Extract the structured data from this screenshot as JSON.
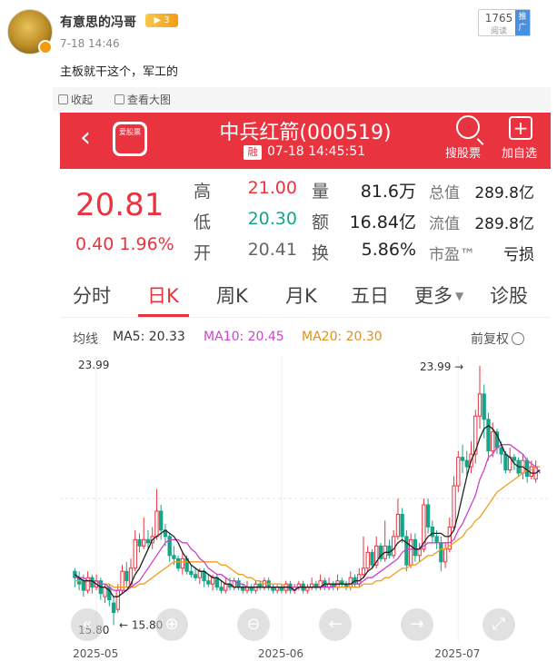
{
  "post": {
    "user_name": "有意思的冯哥",
    "vip_label": "▶ 3",
    "time": "7-18 14:46",
    "text": "主板就干这个，军工的",
    "read_count": "1765",
    "read_label": "阅读",
    "push_label": "推广"
  },
  "image_toolbar": {
    "collapse_label": "收起",
    "view_large_label": "查看大图"
  },
  "stock": {
    "app_logo_text": "爱股票",
    "title": "中兵红箭(000519)",
    "rong": "融",
    "update_time": "07-18 14:45:51",
    "search_label": "搜股票",
    "add_label": "加自选",
    "price": "20.81",
    "change": "0.40",
    "change_pct": "1.96%",
    "quote": {
      "high_label": "高",
      "high": "21.00",
      "low_label": "低",
      "low": "20.30",
      "open_label": "开",
      "open": "20.41",
      "volume_label": "量",
      "volume": "81.6万",
      "amount_label": "额",
      "amount": "16.84亿",
      "turnover_label": "换",
      "turnover": "5.86%",
      "total_mv_label": "总值",
      "total_mv": "289.8亿",
      "float_mv_label": "流值",
      "float_mv": "289.8亿",
      "pe_label": "市盈™",
      "pe": "亏损"
    },
    "tabs": [
      "分时",
      "日K",
      "周K",
      "月K",
      "五日",
      "更多",
      "诊股"
    ],
    "active_tab": "日K",
    "ma": {
      "label": "均线",
      "ma5": "MA5: 20.33",
      "ma10": "MA10: 20.45",
      "ma20": "MA20: 20.30",
      "adjust_label": "前复权"
    },
    "colors": {
      "up": "#e9333f",
      "down": "#17a589",
      "ma5": "#222222",
      "ma10": "#cc44cc",
      "ma20": "#f0a020"
    }
  },
  "chart_data": {
    "type": "candlestick",
    "y_max_label": "23.99",
    "y_min_label": "15.80",
    "high_marker": "23.99",
    "low_marker": "15.80",
    "ylim": [
      15.3,
      24.3
    ],
    "x_labels": [
      "2025-05",
      "2025-06",
      "2025-07"
    ],
    "x_label_index": [
      5,
      48,
      89
    ],
    "candles": [
      [
        17.5,
        17.3,
        17.6,
        17.0
      ],
      [
        17.3,
        17.1,
        17.5,
        16.9
      ],
      [
        17.2,
        16.9,
        17.4,
        16.7
      ],
      [
        16.9,
        17.3,
        17.5,
        16.8
      ],
      [
        17.3,
        17.0,
        17.4,
        16.8
      ],
      [
        17.0,
        17.2,
        17.4,
        16.9
      ],
      [
        17.2,
        16.8,
        17.3,
        16.6
      ],
      [
        16.7,
        17.0,
        17.1,
        16.5
      ],
      [
        17.0,
        16.6,
        17.1,
        16.4
      ],
      [
        16.5,
        16.2,
        16.7,
        15.8
      ],
      [
        16.3,
        16.9,
        17.1,
        16.2
      ],
      [
        16.9,
        17.5,
        17.7,
        16.8
      ],
      [
        17.5,
        17.2,
        17.8,
        17.0
      ],
      [
        17.1,
        17.6,
        17.9,
        17.0
      ],
      [
        17.6,
        18.5,
        18.8,
        17.5
      ],
      [
        18.5,
        18.3,
        18.7,
        18.1
      ],
      [
        18.3,
        18.5,
        19.2,
        18.2
      ],
      [
        18.5,
        18.4,
        18.8,
        18.2
      ],
      [
        18.4,
        18.6,
        18.9,
        18.2
      ],
      [
        18.6,
        19.4,
        20.1,
        18.5
      ],
      [
        19.4,
        18.8,
        19.6,
        18.5
      ],
      [
        18.8,
        18.6,
        19.0,
        18.3
      ],
      [
        18.6,
        18.0,
        18.7,
        17.8
      ],
      [
        18.0,
        17.9,
        18.3,
        17.7
      ],
      [
        17.9,
        17.6,
        18.0,
        17.5
      ],
      [
        17.6,
        17.9,
        18.1,
        17.4
      ],
      [
        17.9,
        17.5,
        18.0,
        17.4
      ],
      [
        17.5,
        17.4,
        17.7,
        17.3
      ],
      [
        17.4,
        17.3,
        17.6,
        17.2
      ],
      [
        17.3,
        17.5,
        17.6,
        17.1
      ],
      [
        17.5,
        17.2,
        17.6,
        17.0
      ],
      [
        17.2,
        17.1,
        17.4,
        17.0
      ],
      [
        17.1,
        17.3,
        17.4,
        16.9
      ],
      [
        17.3,
        17.0,
        17.4,
        16.9
      ],
      [
        17.0,
        16.9,
        17.2,
        16.8
      ],
      [
        16.9,
        17.1,
        17.3,
        16.8
      ],
      [
        17.1,
        17.0,
        17.3,
        16.9
      ],
      [
        17.0,
        17.2,
        17.3,
        16.9
      ],
      [
        17.2,
        17.0,
        17.3,
        16.9
      ],
      [
        17.0,
        16.9,
        17.1,
        16.8
      ],
      [
        16.9,
        17.0,
        17.2,
        16.8
      ],
      [
        17.0,
        16.9,
        17.1,
        16.8
      ],
      [
        16.9,
        17.1,
        17.2,
        16.8
      ],
      [
        17.1,
        17.0,
        17.2,
        16.9
      ],
      [
        17.0,
        17.2,
        17.3,
        16.9
      ],
      [
        17.2,
        17.0,
        17.3,
        16.9
      ],
      [
        17.0,
        16.9,
        17.1,
        16.8
      ],
      [
        16.9,
        17.0,
        17.1,
        16.8
      ],
      [
        17.0,
        16.9,
        17.1,
        16.8
      ],
      [
        16.9,
        17.1,
        17.2,
        16.8
      ],
      [
        17.1,
        16.9,
        17.2,
        16.8
      ],
      [
        16.9,
        17.0,
        17.1,
        16.8
      ],
      [
        17.0,
        17.1,
        17.2,
        16.9
      ],
      [
        17.1,
        16.9,
        17.2,
        16.8
      ],
      [
        16.9,
        17.0,
        17.1,
        16.8
      ],
      [
        17.0,
        17.1,
        17.3,
        16.9
      ],
      [
        17.1,
        17.0,
        17.2,
        16.9
      ],
      [
        17.0,
        17.2,
        17.4,
        16.9
      ],
      [
        17.2,
        17.0,
        17.3,
        16.9
      ],
      [
        17.0,
        17.1,
        17.3,
        16.9
      ],
      [
        17.1,
        17.0,
        17.2,
        16.9
      ],
      [
        17.0,
        17.2,
        17.4,
        16.9
      ],
      [
        17.2,
        17.1,
        17.3,
        17.0
      ],
      [
        17.1,
        17.0,
        17.2,
        16.9
      ],
      [
        17.0,
        17.3,
        17.5,
        16.9
      ],
      [
        17.3,
        17.1,
        17.4,
        17.0
      ],
      [
        17.1,
        17.4,
        17.6,
        17.0
      ],
      [
        17.4,
        17.6,
        18.6,
        17.3
      ],
      [
        17.6,
        18.1,
        18.3,
        17.5
      ],
      [
        18.1,
        17.7,
        18.2,
        17.6
      ],
      [
        17.7,
        18.3,
        18.6,
        17.6
      ],
      [
        18.3,
        17.9,
        18.4,
        17.8
      ],
      [
        17.9,
        18.3,
        19.1,
        17.8
      ],
      [
        18.3,
        18.0,
        18.5,
        17.9
      ],
      [
        18.0,
        18.6,
        18.8,
        17.9
      ],
      [
        18.6,
        19.3,
        19.8,
        18.5
      ],
      [
        19.3,
        18.6,
        19.5,
        18.4
      ],
      [
        18.6,
        17.7,
        18.8,
        17.5
      ],
      [
        17.7,
        18.5,
        18.7,
        17.6
      ],
      [
        18.5,
        18.0,
        18.7,
        17.8
      ],
      [
        18.0,
        18.2,
        18.4,
        17.8
      ],
      [
        18.2,
        19.6,
        19.8,
        18.1
      ],
      [
        19.6,
        18.9,
        19.8,
        18.7
      ],
      [
        18.9,
        18.6,
        19.1,
        18.4
      ],
      [
        18.6,
        18.4,
        18.8,
        18.2
      ],
      [
        18.4,
        17.8,
        18.6,
        17.5
      ],
      [
        17.8,
        18.2,
        18.4,
        17.6
      ],
      [
        18.2,
        18.9,
        19.2,
        18.1
      ],
      [
        18.9,
        20.2,
        20.5,
        18.8
      ],
      [
        20.2,
        21.1,
        21.3,
        20.0
      ],
      [
        21.1,
        21.0,
        21.5,
        20.6
      ],
      [
        21.0,
        20.8,
        21.3,
        20.5
      ],
      [
        20.8,
        21.2,
        21.6,
        20.6
      ],
      [
        21.2,
        22.4,
        22.6,
        20.9
      ],
      [
        22.4,
        23.1,
        23.99,
        22.0
      ],
      [
        23.1,
        22.3,
        23.4,
        21.7
      ],
      [
        22.3,
        21.3,
        22.5,
        21.0
      ],
      [
        21.3,
        21.9,
        22.2,
        21.1
      ],
      [
        21.9,
        21.4,
        22.0,
        21.2
      ],
      [
        21.4,
        21.2,
        21.6,
        20.9
      ],
      [
        21.2,
        20.7,
        21.3,
        20.6
      ],
      [
        20.7,
        21.1,
        21.4,
        20.6
      ],
      [
        21.1,
        21.0,
        21.2,
        20.7
      ],
      [
        21.0,
        20.6,
        21.1,
        20.5
      ],
      [
        20.6,
        21.0,
        21.2,
        20.4
      ],
      [
        21.0,
        20.5,
        21.1,
        20.3
      ],
      [
        20.5,
        20.8,
        21.0,
        20.4
      ],
      [
        20.41,
        20.81,
        21.0,
        20.3
      ]
    ],
    "ma5": [
      17.4,
      17.3,
      17.2,
      17.2,
      17.2,
      17.1,
      17.0,
      17.0,
      16.9,
      16.7,
      16.7,
      16.8,
      16.9,
      17.1,
      17.4,
      17.6,
      17.9,
      18.2,
      18.5,
      18.6,
      18.7,
      18.8,
      18.7,
      18.6,
      18.4,
      18.1,
      17.9,
      17.7,
      17.6,
      17.5,
      17.5,
      17.4,
      17.3,
      17.3,
      17.2,
      17.1,
      17.1,
      17.0,
      17.0,
      17.0,
      17.0,
      17.0,
      17.0,
      17.0,
      17.0,
      17.0,
      17.0,
      17.0,
      17.0,
      17.0,
      17.0,
      16.9,
      17.0,
      17.0,
      17.0,
      17.0,
      17.0,
      17.0,
      17.1,
      17.1,
      17.1,
      17.1,
      17.1,
      17.1,
      17.1,
      17.2,
      17.2,
      17.3,
      17.5,
      17.6,
      17.8,
      18.0,
      18.1,
      18.1,
      18.2,
      18.4,
      18.5,
      18.4,
      18.3,
      18.2,
      18.2,
      18.4,
      18.6,
      18.7,
      18.7,
      18.7,
      18.6,
      18.6,
      18.8,
      19.3,
      19.9,
      20.5,
      21.0,
      21.3,
      21.7,
      22.0,
      22.1,
      22.0,
      21.8,
      21.5,
      21.2,
      21.1,
      20.9,
      20.8,
      20.8,
      20.7,
      20.6,
      20.6,
      20.7
    ],
    "ma10": [
      17.3,
      17.3,
      17.3,
      17.2,
      17.2,
      17.2,
      17.1,
      17.1,
      17.0,
      16.9,
      16.9,
      16.9,
      16.9,
      17.0,
      17.1,
      17.2,
      17.4,
      17.6,
      17.8,
      18.0,
      18.2,
      18.4,
      18.5,
      18.5,
      18.5,
      18.4,
      18.4,
      18.2,
      18.1,
      17.9,
      17.8,
      17.6,
      17.5,
      17.4,
      17.4,
      17.3,
      17.2,
      17.2,
      17.1,
      17.1,
      17.0,
      17.0,
      17.0,
      17.0,
      17.0,
      17.0,
      17.0,
      17.0,
      17.0,
      17.0,
      17.0,
      17.0,
      17.0,
      17.0,
      17.0,
      17.0,
      17.0,
      17.0,
      17.0,
      17.0,
      17.0,
      17.1,
      17.1,
      17.1,
      17.1,
      17.1,
      17.1,
      17.2,
      17.3,
      17.3,
      17.4,
      17.5,
      17.6,
      17.7,
      17.8,
      17.9,
      18.1,
      18.2,
      18.2,
      18.2,
      18.2,
      18.3,
      18.4,
      18.4,
      18.4,
      18.4,
      18.4,
      18.4,
      18.5,
      18.8,
      19.0,
      19.3,
      19.6,
      19.9,
      20.4,
      20.7,
      21.1,
      21.2,
      21.4,
      21.5,
      21.5,
      21.5,
      21.4,
      21.3,
      21.2,
      21.0,
      20.9,
      20.8,
      20.6
    ],
    "ma20": [
      17.2,
      17.2,
      17.2,
      17.2,
      17.2,
      17.2,
      17.1,
      17.1,
      17.1,
      17.0,
      17.0,
      17.0,
      17.0,
      17.0,
      17.0,
      17.1,
      17.1,
      17.2,
      17.3,
      17.4,
      17.5,
      17.6,
      17.7,
      17.8,
      17.8,
      17.8,
      17.8,
      17.8,
      17.8,
      17.8,
      17.8,
      17.8,
      17.8,
      17.8,
      17.7,
      17.7,
      17.6,
      17.5,
      17.4,
      17.4,
      17.3,
      17.3,
      17.2,
      17.2,
      17.1,
      17.1,
      17.1,
      17.1,
      17.1,
      17.0,
      17.0,
      17.0,
      17.0,
      17.0,
      17.0,
      17.0,
      17.0,
      17.0,
      17.0,
      17.0,
      17.0,
      17.0,
      17.0,
      17.0,
      17.0,
      17.0,
      17.0,
      17.1,
      17.1,
      17.1,
      17.2,
      17.2,
      17.3,
      17.3,
      17.4,
      17.5,
      17.6,
      17.6,
      17.7,
      17.7,
      17.8,
      17.9,
      18.0,
      18.0,
      18.1,
      18.2,
      18.2,
      18.3,
      18.4,
      18.5,
      18.6,
      18.8,
      18.9,
      19.1,
      19.2,
      19.4,
      19.6,
      19.8,
      20.0,
      20.1,
      20.2,
      20.3,
      20.4,
      20.5,
      20.6,
      20.7,
      20.7,
      20.8,
      20.8
    ]
  }
}
